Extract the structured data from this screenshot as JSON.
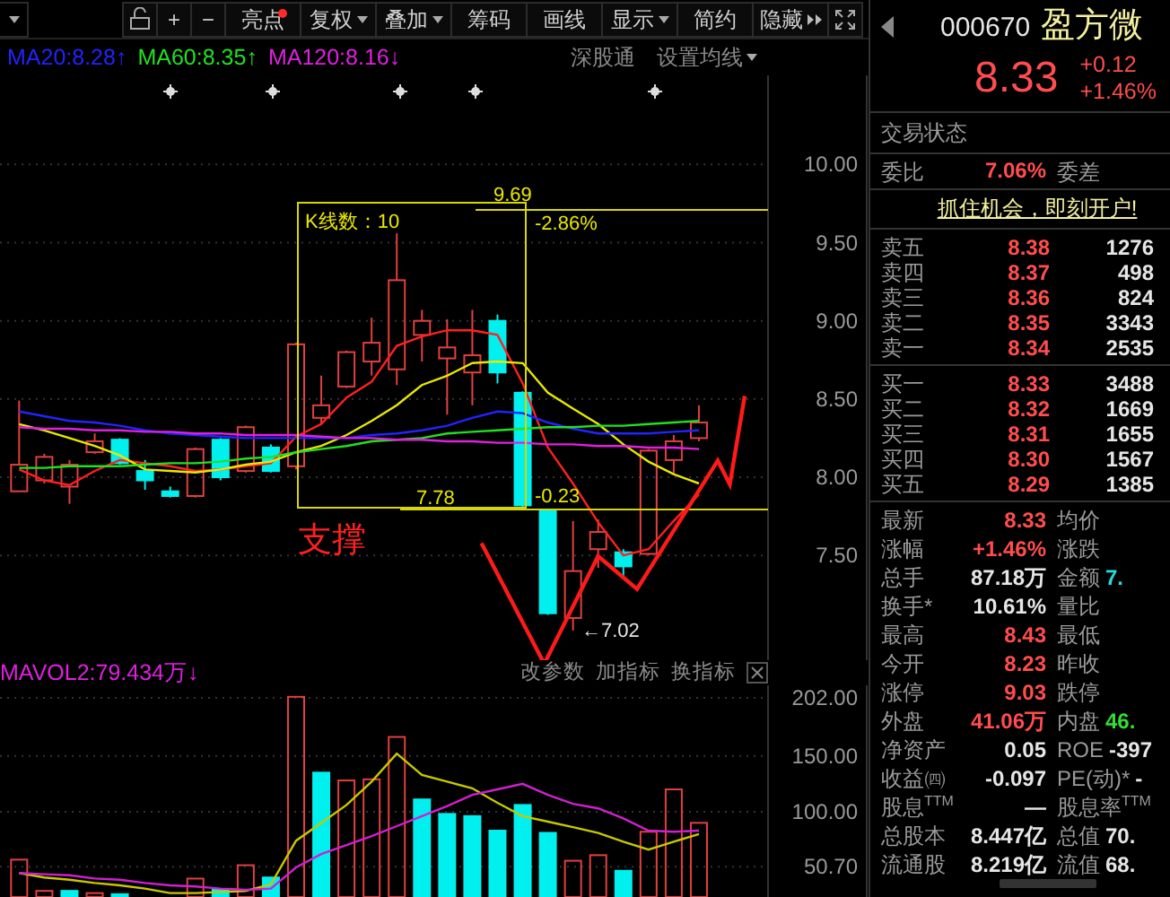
{
  "toolbar": {
    "buttons": [
      {
        "kind": "lock",
        "dropdown": false,
        "dot": false
      },
      {
        "kind": "text",
        "label": "+",
        "dropdown": false,
        "dot": false
      },
      {
        "kind": "text",
        "label": "−",
        "dropdown": false,
        "dot": false
      },
      {
        "kind": "text",
        "label": "亮点",
        "dropdown": false,
        "dot": true
      },
      {
        "kind": "text",
        "label": "复权",
        "dropdown": true,
        "dot": false
      },
      {
        "kind": "text",
        "label": "叠加",
        "dropdown": true,
        "dot": false
      },
      {
        "kind": "text",
        "label": "筹码",
        "dropdown": false,
        "dot": false
      },
      {
        "kind": "text",
        "label": "画线",
        "dropdown": false,
        "dot": false
      },
      {
        "kind": "text",
        "label": "显示",
        "dropdown": true,
        "dot": false
      },
      {
        "kind": "text",
        "label": "简约",
        "dropdown": false,
        "dot": false
      },
      {
        "kind": "more",
        "label": "隐藏",
        "dropdown": false,
        "dot": false
      },
      {
        "kind": "expand",
        "dropdown": false,
        "dot": false
      }
    ]
  },
  "ma_legend": {
    "items": [
      {
        "label": "MA20:8.28",
        "arrow": "↑",
        "color": "#2323ff"
      },
      {
        "label": "MA60:8.35",
        "arrow": "↑",
        "color": "#22e022"
      },
      {
        "label": "MA120:8.16",
        "arrow": "↓",
        "color": "#e020e0"
      }
    ],
    "links": [
      {
        "label": "深股通",
        "dropdown": false
      },
      {
        "label": "设置均线",
        "dropdown": true
      }
    ]
  },
  "price_chart": {
    "annotations": {
      "bar_count": "K线数：10",
      "high": "9.69",
      "high_change": "-2.86%",
      "low": "7.78",
      "low_change": "-0.23",
      "support": "支撑",
      "min": "←7.02"
    },
    "chart_data": {
      "type": "candlestick",
      "grid": true,
      "ylim": [
        6.83,
        10.57
      ],
      "ohlc": [
        [
          7.91,
          8.49,
          7.91,
          8.08
        ],
        [
          7.98,
          8.15,
          7.96,
          8.13
        ],
        [
          7.94,
          8.11,
          7.83,
          8.08
        ],
        [
          8.16,
          8.28,
          8.15,
          8.23
        ],
        [
          8.24,
          8.25,
          8.08,
          8.09
        ],
        [
          8.04,
          8.11,
          7.92,
          7.98
        ],
        [
          7.91,
          7.94,
          7.87,
          7.88
        ],
        [
          7.88,
          8.19,
          7.87,
          8.18
        ],
        [
          8.24,
          8.25,
          7.98,
          8.0
        ],
        [
          8.04,
          8.33,
          8.03,
          8.32
        ],
        [
          8.19,
          8.21,
          8.03,
          8.04
        ],
        [
          8.07,
          8.86,
          8.05,
          8.85
        ],
        [
          8.38,
          8.65,
          8.34,
          8.46
        ],
        [
          8.58,
          8.81,
          8.57,
          8.8
        ],
        [
          8.74,
          9.02,
          8.65,
          8.86
        ],
        [
          8.69,
          9.56,
          8.59,
          9.26
        ],
        [
          8.91,
          9.07,
          8.74,
          9.0
        ],
        [
          8.76,
          9.01,
          8.4,
          8.83
        ],
        [
          8.67,
          9.07,
          8.46,
          8.78
        ],
        [
          9.0,
          9.04,
          8.6,
          8.67
        ],
        [
          8.54,
          8.55,
          7.81,
          7.82
        ],
        [
          7.79,
          7.8,
          7.12,
          7.13
        ],
        [
          7.1,
          7.72,
          7.02,
          7.4
        ],
        [
          7.54,
          7.73,
          7.42,
          7.65
        ],
        [
          7.52,
          7.54,
          7.37,
          7.43
        ],
        [
          7.51,
          8.18,
          7.5,
          8.17
        ],
        [
          8.11,
          8.27,
          8.02,
          8.23
        ],
        [
          8.25,
          8.46,
          8.23,
          8.35
        ]
      ],
      "yticks": [
        {
          "value": 10,
          "label": "10.00"
        },
        {
          "value": 9.5,
          "label": "9.50"
        },
        {
          "value": 9,
          "label": "9.00"
        },
        {
          "value": 8.5,
          "label": "8.50"
        },
        {
          "value": 8,
          "label": "8.00"
        },
        {
          "value": 7.5,
          "label": "7.50"
        }
      ],
      "series": [
        {
          "type": "line",
          "color": "#ff2020",
          "values": [
            8.05,
            7.98,
            7.95,
            8.04,
            8.11,
            8.09,
            8.07,
            8.04,
            8.05,
            8.07,
            8.09,
            8.26,
            8.34,
            8.51,
            8.61,
            8.84,
            8.9,
            8.94,
            8.94,
            8.91,
            8.6,
            8.19,
            7.96,
            7.71,
            7.5,
            7.54,
            7.72,
            7.89
          ]
        },
        {
          "type": "line",
          "color": "#e8e800",
          "values": [
            8.34,
            8.3,
            8.25,
            8.2,
            8.14,
            8.05,
            8.04,
            8.03,
            8.05,
            8.08,
            8.1,
            8.16,
            8.2,
            8.27,
            8.36,
            8.46,
            8.59,
            8.65,
            8.73,
            8.74,
            8.73,
            8.54,
            8.44,
            8.34,
            8.21,
            8.1,
            8.02,
            7.96
          ]
        },
        {
          "type": "line",
          "color": "#2323ff",
          "values": [
            8.42,
            8.39,
            8.36,
            8.35,
            8.33,
            8.3,
            8.28,
            8.27,
            8.26,
            8.25,
            8.25,
            8.25,
            8.25,
            8.25,
            8.27,
            8.28,
            8.3,
            8.33,
            8.38,
            8.42,
            8.41,
            8.35,
            8.31,
            8.28,
            8.28,
            8.28,
            8.29,
            8.3
          ]
        },
        {
          "type": "line",
          "color": "#22e022",
          "values": [
            8.06,
            8.06,
            8.07,
            8.07,
            8.07,
            8.08,
            8.09,
            8.09,
            8.1,
            8.12,
            8.13,
            8.16,
            8.18,
            8.2,
            8.23,
            8.24,
            8.25,
            8.28,
            8.29,
            8.3,
            8.31,
            8.32,
            8.32,
            8.33,
            8.33,
            8.34,
            8.35,
            8.36
          ]
        },
        {
          "type": "line",
          "color": "#e020e0",
          "values": [
            8.32,
            8.31,
            8.31,
            8.3,
            8.3,
            8.29,
            8.29,
            8.28,
            8.28,
            8.27,
            8.27,
            8.27,
            8.26,
            8.25,
            8.25,
            8.24,
            8.24,
            8.23,
            8.23,
            8.22,
            8.22,
            8.21,
            8.21,
            8.2,
            8.2,
            8.19,
            8.19,
            8.18
          ]
        }
      ]
    }
  },
  "volume_panel": {
    "legend": {
      "label": "MAVOL2:79.434万",
      "arrow": "↓"
    },
    "buttons": [
      "改参数",
      "加指标",
      "换指标"
    ],
    "chart_data": {
      "type": "bar",
      "grid": true,
      "ylim": [
        23.5,
        213.3
      ],
      "yticks": [
        {
          "value": 202,
          "label": "202.00"
        },
        {
          "value": 150,
          "label": "150.00"
        },
        {
          "value": 100,
          "label": "100.00"
        },
        {
          "value": 50.7,
          "label": "50.70"
        }
      ],
      "series": [
        {
          "type": "bar",
          "color": "#e04040",
          "values": [
            57,
            29,
            null,
            27,
            null,
            null,
            null,
            40,
            null,
            52,
            null,
            203,
            null,
            128,
            129,
            167,
            null,
            null,
            null,
            null,
            null,
            null,
            56,
            61,
            null,
            82,
            120,
            90
          ]
        },
        {
          "type": "bar",
          "color": "#00f0f0",
          "values": [
            null,
            null,
            29,
            null,
            26,
            null,
            null,
            null,
            30,
            null,
            41,
            null,
            135,
            null,
            null,
            null,
            111,
            98,
            96,
            83,
            106,
            81,
            null,
            null,
            47,
            null,
            null,
            null
          ]
        },
        {
          "type": "line",
          "color": "#c8c800",
          "values": [
            45,
            41,
            39,
            36,
            34,
            31,
            27,
            27,
            28,
            29,
            35,
            74,
            90,
            106,
            127,
            152,
            133,
            127,
            121,
            108,
            96,
            91,
            86,
            81,
            73,
            66,
            73,
            80
          ]
        },
        {
          "type": "line",
          "color": "#d020d0",
          "values": [
            45,
            44,
            43,
            40,
            39,
            36,
            34,
            33,
            31,
            30,
            31,
            50,
            62,
            70,
            78,
            87,
            96,
            105,
            115,
            120,
            125,
            115,
            107,
            103,
            94,
            83,
            82,
            83
          ]
        }
      ]
    }
  },
  "quote": {
    "code": "000670",
    "name": "盈方微",
    "price": "8.33",
    "change": "+0.12",
    "change_pct": "+1.46%",
    "status_label": "交易状态",
    "ratio": {
      "label": "委比",
      "value": "7.06%",
      "diff_label": "委差"
    },
    "promo_link": "抓住机会，即刻开户!",
    "asks": [
      {
        "label": "卖五",
        "price": "8.38",
        "volume": "1276"
      },
      {
        "label": "卖四",
        "price": "8.37",
        "volume": "498"
      },
      {
        "label": "卖三",
        "price": "8.36",
        "volume": "824"
      },
      {
        "label": "卖二",
        "price": "8.35",
        "volume": "3343"
      },
      {
        "label": "卖一",
        "price": "8.34",
        "volume": "2535"
      }
    ],
    "bids": [
      {
        "label": "买一",
        "price": "8.33",
        "volume": "3488"
      },
      {
        "label": "买二",
        "price": "8.32",
        "volume": "1669"
      },
      {
        "label": "买三",
        "price": "8.31",
        "volume": "1655"
      },
      {
        "label": "买四",
        "price": "8.30",
        "volume": "1567"
      },
      {
        "label": "买五",
        "price": "8.29",
        "volume": "1385"
      }
    ],
    "stats": [
      {
        "label": "最新",
        "value": "8.33",
        "color": "#ff4d4d",
        "second": {
          "label": "均价"
        }
      },
      {
        "label": "涨幅",
        "value": "+1.46%",
        "color": "#ff4d4d",
        "second": {
          "label": "涨跌"
        }
      },
      {
        "label": "总手",
        "value": "87.18万",
        "color": "#e6e6e6",
        "second": {
          "label": "金额",
          "value": "7.",
          "color": "#22dddd"
        }
      },
      {
        "label": "换手*",
        "value": "10.61%",
        "color": "#e6e6e6",
        "second": {
          "label": "量比"
        }
      },
      {
        "label": "最高",
        "value": "8.43",
        "color": "#ff4d4d",
        "second": {
          "label": "最低"
        }
      },
      {
        "label": "今开",
        "value": "8.23",
        "color": "#ff4d4d",
        "second": {
          "label": "昨收"
        }
      },
      {
        "label": "涨停",
        "value": "9.03",
        "color": "#ff4d4d",
        "second": {
          "label": "跌停"
        }
      },
      {
        "label": "外盘",
        "value": "41.06万",
        "color": "#ff4d4d",
        "second": {
          "label": "内盘",
          "value": "46.",
          "color": "#33dd33"
        }
      },
      {
        "label": "净资产",
        "value": "0.05",
        "color": "#e6e6e6",
        "second": {
          "label": "ROE",
          "value": "-397",
          "color": "#e6e6e6"
        }
      },
      {
        "label": "收益㈣",
        "value": "-0.097",
        "color": "#e6e6e6",
        "second": {
          "label": "PE(动)*",
          "value": "-",
          "color": "#e6e6e6"
        }
      },
      {
        "label": "股息$^{TTM}$",
        "value": "—",
        "color": "#e6e6e6",
        "second": {
          "label": "股息率$^{TTM}$"
        }
      },
      {
        "label": "总股本",
        "value": "8.447亿",
        "color": "#e6e6e6",
        "second": {
          "label": "总值",
          "value": "70.",
          "color": "#e6e6e6"
        }
      },
      {
        "label": "流通股",
        "value": "8.219亿",
        "color": "#e6e6e6",
        "second": {
          "label": "流值",
          "value": "68.",
          "color": "#e6e6e6"
        }
      }
    ]
  }
}
